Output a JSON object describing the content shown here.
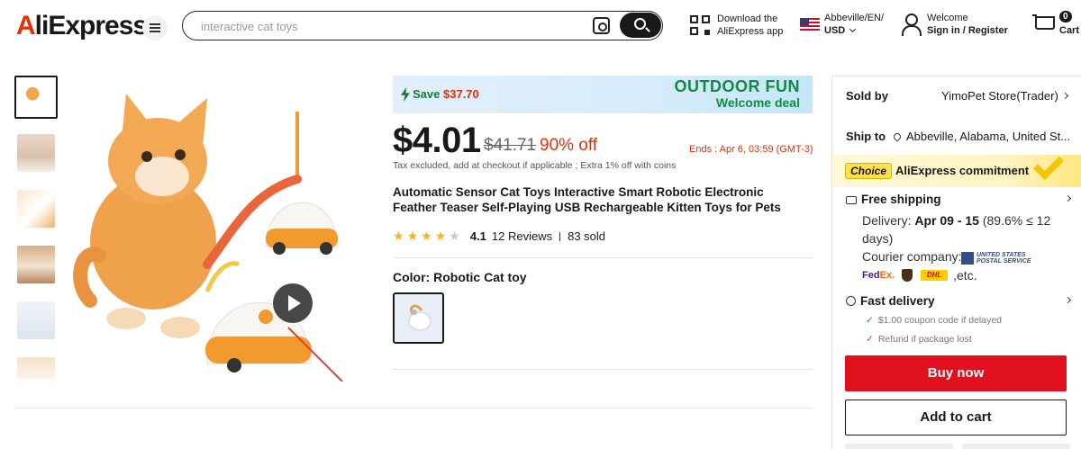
{
  "header": {
    "logo_a": "A",
    "logo_rest": "liExpress",
    "search_placeholder": "interactive cat toys",
    "download_line1": "Download the",
    "download_line2": "AliExpress app",
    "locale_line1": "Abbeville/EN/",
    "locale_line2": "USD",
    "welcome": "Welcome",
    "signin": "Sign in / Register",
    "cart_count": "0",
    "cart_label": "Cart",
    "brand_color": "#e62e04"
  },
  "gallery": {
    "thumbnail_count": 6,
    "active_index": 0
  },
  "promo": {
    "save_label": "Save",
    "save_amount": "$37.70",
    "headline": "OUTDOOR FUN",
    "subline": "Welcome deal"
  },
  "pricing": {
    "price": "$4.01",
    "original_price": "$41.71",
    "discount": "90% off",
    "ends": "Ends :  Apr 6, 03:59 (GMT-3)",
    "tax_note": "Tax excluded, add at checkout if applicable ; Extra 1% off with coins"
  },
  "product": {
    "title": "Automatic Sensor Cat Toys Interactive Smart Robotic Electronic Feather Teaser Self-Playing USB Rechargeable Kitten Toys for Pets",
    "stars_filled": 4,
    "stars_total": 5,
    "rating": "4.1",
    "reviews": "12 Reviews",
    "sold": "83 sold",
    "color_label": "Color: Robotic Cat toy"
  },
  "panel": {
    "sold_by_label": "Sold by",
    "sold_by_value": "YimoPet Store(Trader)",
    "ship_to_label": "Ship to",
    "ship_to_value": "Abbeville, Alabama, United St...",
    "choice_tag": "Choice",
    "commitment": "AliExpress commitment",
    "free_shipping": "Free shipping",
    "delivery_prefix": "Delivery: ",
    "delivery_dates": "Apr 09 - 15",
    "delivery_suffix": " (89.6% ≤ 12 days)",
    "courier_label": "Courier company:",
    "usps_line1": "UNITED STATES",
    "usps_line2": "POSTAL SERVICE",
    "fedex_a": "Fed",
    "fedex_b": "Ex.",
    "dhl": "DHL",
    "etc": ",etc.",
    "fast_delivery": "Fast delivery",
    "perk1": "$1.00 coupon code if delayed",
    "perk2": "Refund if package lost",
    "buy_now": "Buy now",
    "add_to_cart": "Add to cart",
    "buy_color": "#e0101e"
  }
}
